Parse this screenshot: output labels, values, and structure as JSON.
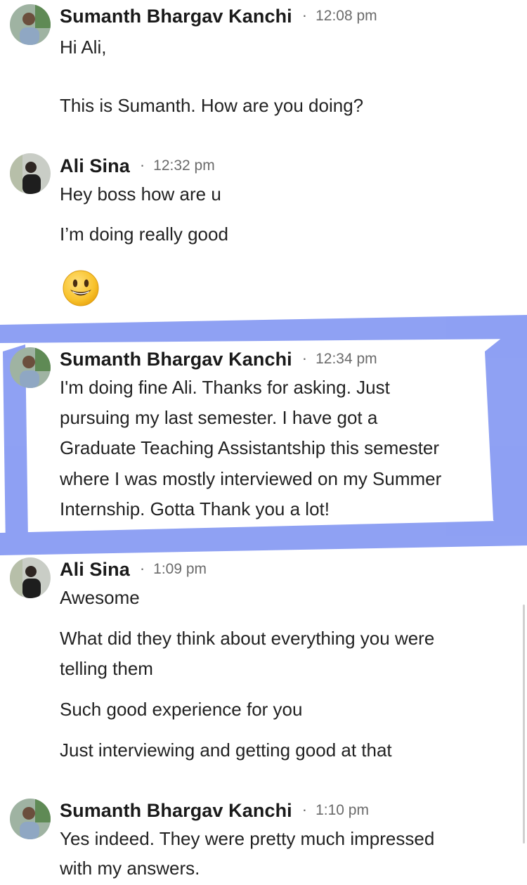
{
  "messages": [
    {
      "sender": "Sumanth Bhargav Kanchi",
      "separator": "·",
      "time": "12:08 pm",
      "lines": [
        "Hi Ali,",
        "This is Sumanth. How are you doing?"
      ]
    },
    {
      "sender": "Ali Sina",
      "separator": "·",
      "time": "12:32 pm",
      "lines": [
        "Hey boss how are u",
        "I’m doing really good"
      ],
      "emoji": "smiling-face-icon"
    },
    {
      "sender": "Sumanth Bhargav Kanchi",
      "separator": "·",
      "time": "12:34 pm",
      "lines": [
        "I'm doing fine Ali. Thanks for asking. Just",
        "pursuing my last semester. I have got a",
        "Graduate Teaching Assistantship this semester",
        "where I was mostly interviewed on my Summer",
        "Internship. Gotta Thank you a lot!"
      ]
    },
    {
      "sender": "Ali Sina",
      "separator": "·",
      "time": "1:09 pm",
      "lines": [
        "Awesome",
        "What did they think about everything you were",
        "telling them",
        "Such good experience for you",
        "Just interviewing and getting good at that"
      ]
    },
    {
      "sender": "Sumanth Bhargav Kanchi",
      "separator": "·",
      "time": "1:10 pm",
      "lines": [
        "Yes indeed. They were pretty much impressed",
        "with my answers."
      ]
    }
  ],
  "colors": {
    "highlight": "#6f86f0",
    "name_text": "#1a1a1a",
    "time_text": "#6b6b6b"
  }
}
